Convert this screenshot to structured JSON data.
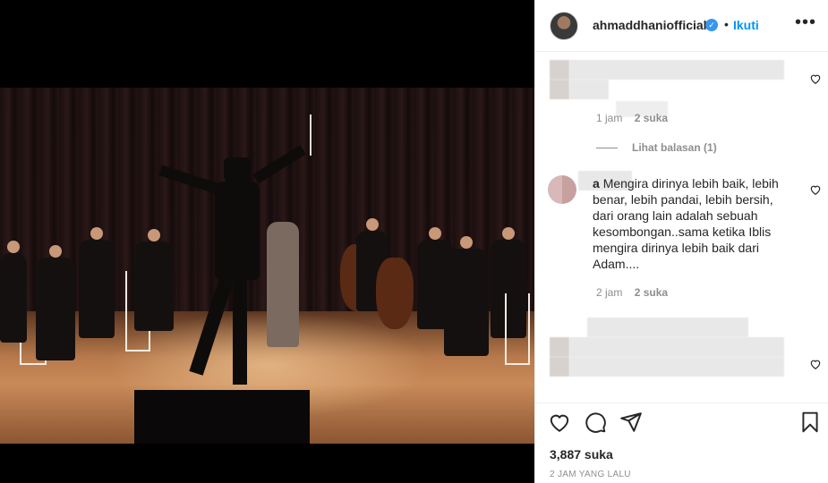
{
  "header": {
    "username": "ahmaddhaniofficial",
    "separator": "•",
    "follow_label": "Ikuti"
  },
  "comments": [
    {
      "text_visible": "",
      "time": "1 jam",
      "likes": "2 suka",
      "obscured": true
    },
    {
      "reply_link": "Lihat balasan (1)"
    },
    {
      "username_partial": "a",
      "text": "Mengira dirinya lebih baik, lebih benar, lebih pandai, lebih bersih, dari orang lain adalah sebuah kesombongan..sama ketika Iblis mengira dirinya lebih baik dari Adam....",
      "time": "2 jam",
      "likes": "2 suka"
    },
    {
      "obscured": true
    }
  ],
  "footer": {
    "likes_count": "3,887 suka",
    "time_ago": "2 JAM YANG LALU"
  },
  "icons": {
    "like": "heart-icon",
    "comment": "comment-bubble-icon",
    "share": "paper-plane-icon",
    "save": "bookmark-icon",
    "more": "more-options-icon",
    "verified": "verified-badge-icon"
  }
}
